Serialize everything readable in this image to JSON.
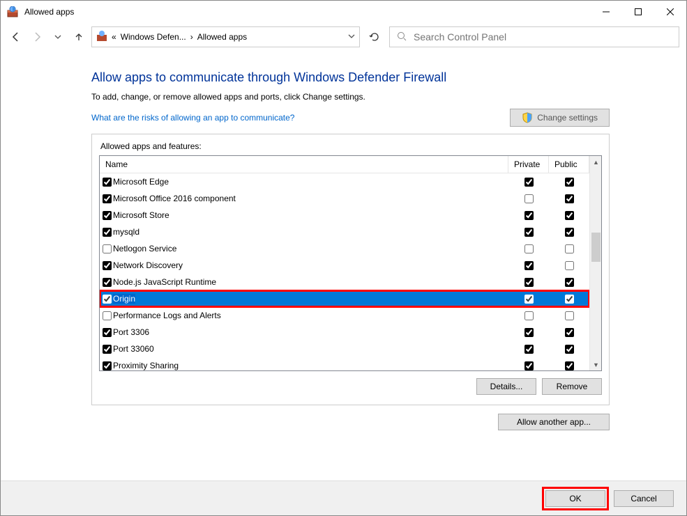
{
  "window": {
    "title": "Allowed apps"
  },
  "breadcrumb": {
    "segment1": "Windows Defen...",
    "segment2": "Allowed apps"
  },
  "search": {
    "placeholder": "Search Control Panel"
  },
  "page": {
    "title": "Allow apps to communicate through Windows Defender Firewall",
    "desc": "To add, change, or remove allowed apps and ports, click Change settings.",
    "risks_link": "What are the risks of allowing an app to communicate?",
    "change_settings": "Change settings",
    "panel_label": "Allowed apps and features:",
    "col_name": "Name",
    "col_private": "Private",
    "col_public": "Public",
    "details": "Details...",
    "remove": "Remove",
    "allow_another": "Allow another app..."
  },
  "apps": [
    {
      "enabled": true,
      "name": "Microsoft Edge",
      "private": true,
      "public": true,
      "selected": false
    },
    {
      "enabled": true,
      "name": "Microsoft Office 2016 component",
      "private": false,
      "public": true,
      "selected": false
    },
    {
      "enabled": true,
      "name": "Microsoft Store",
      "private": true,
      "public": true,
      "selected": false
    },
    {
      "enabled": true,
      "name": "mysqld",
      "private": true,
      "public": true,
      "selected": false
    },
    {
      "enabled": false,
      "name": "Netlogon Service",
      "private": false,
      "public": false,
      "selected": false
    },
    {
      "enabled": true,
      "name": "Network Discovery",
      "private": true,
      "public": false,
      "selected": false
    },
    {
      "enabled": true,
      "name": "Node.js JavaScript Runtime",
      "private": true,
      "public": true,
      "selected": false
    },
    {
      "enabled": true,
      "name": "Origin",
      "private": true,
      "public": true,
      "selected": true,
      "highlight": true
    },
    {
      "enabled": false,
      "name": "Performance Logs and Alerts",
      "private": false,
      "public": false,
      "selected": false
    },
    {
      "enabled": true,
      "name": "Port 3306",
      "private": true,
      "public": true,
      "selected": false
    },
    {
      "enabled": true,
      "name": "Port 33060",
      "private": true,
      "public": true,
      "selected": false
    },
    {
      "enabled": true,
      "name": "Proximity Sharing",
      "private": true,
      "public": true,
      "selected": false
    }
  ],
  "footer": {
    "ok": "OK",
    "cancel": "Cancel"
  }
}
